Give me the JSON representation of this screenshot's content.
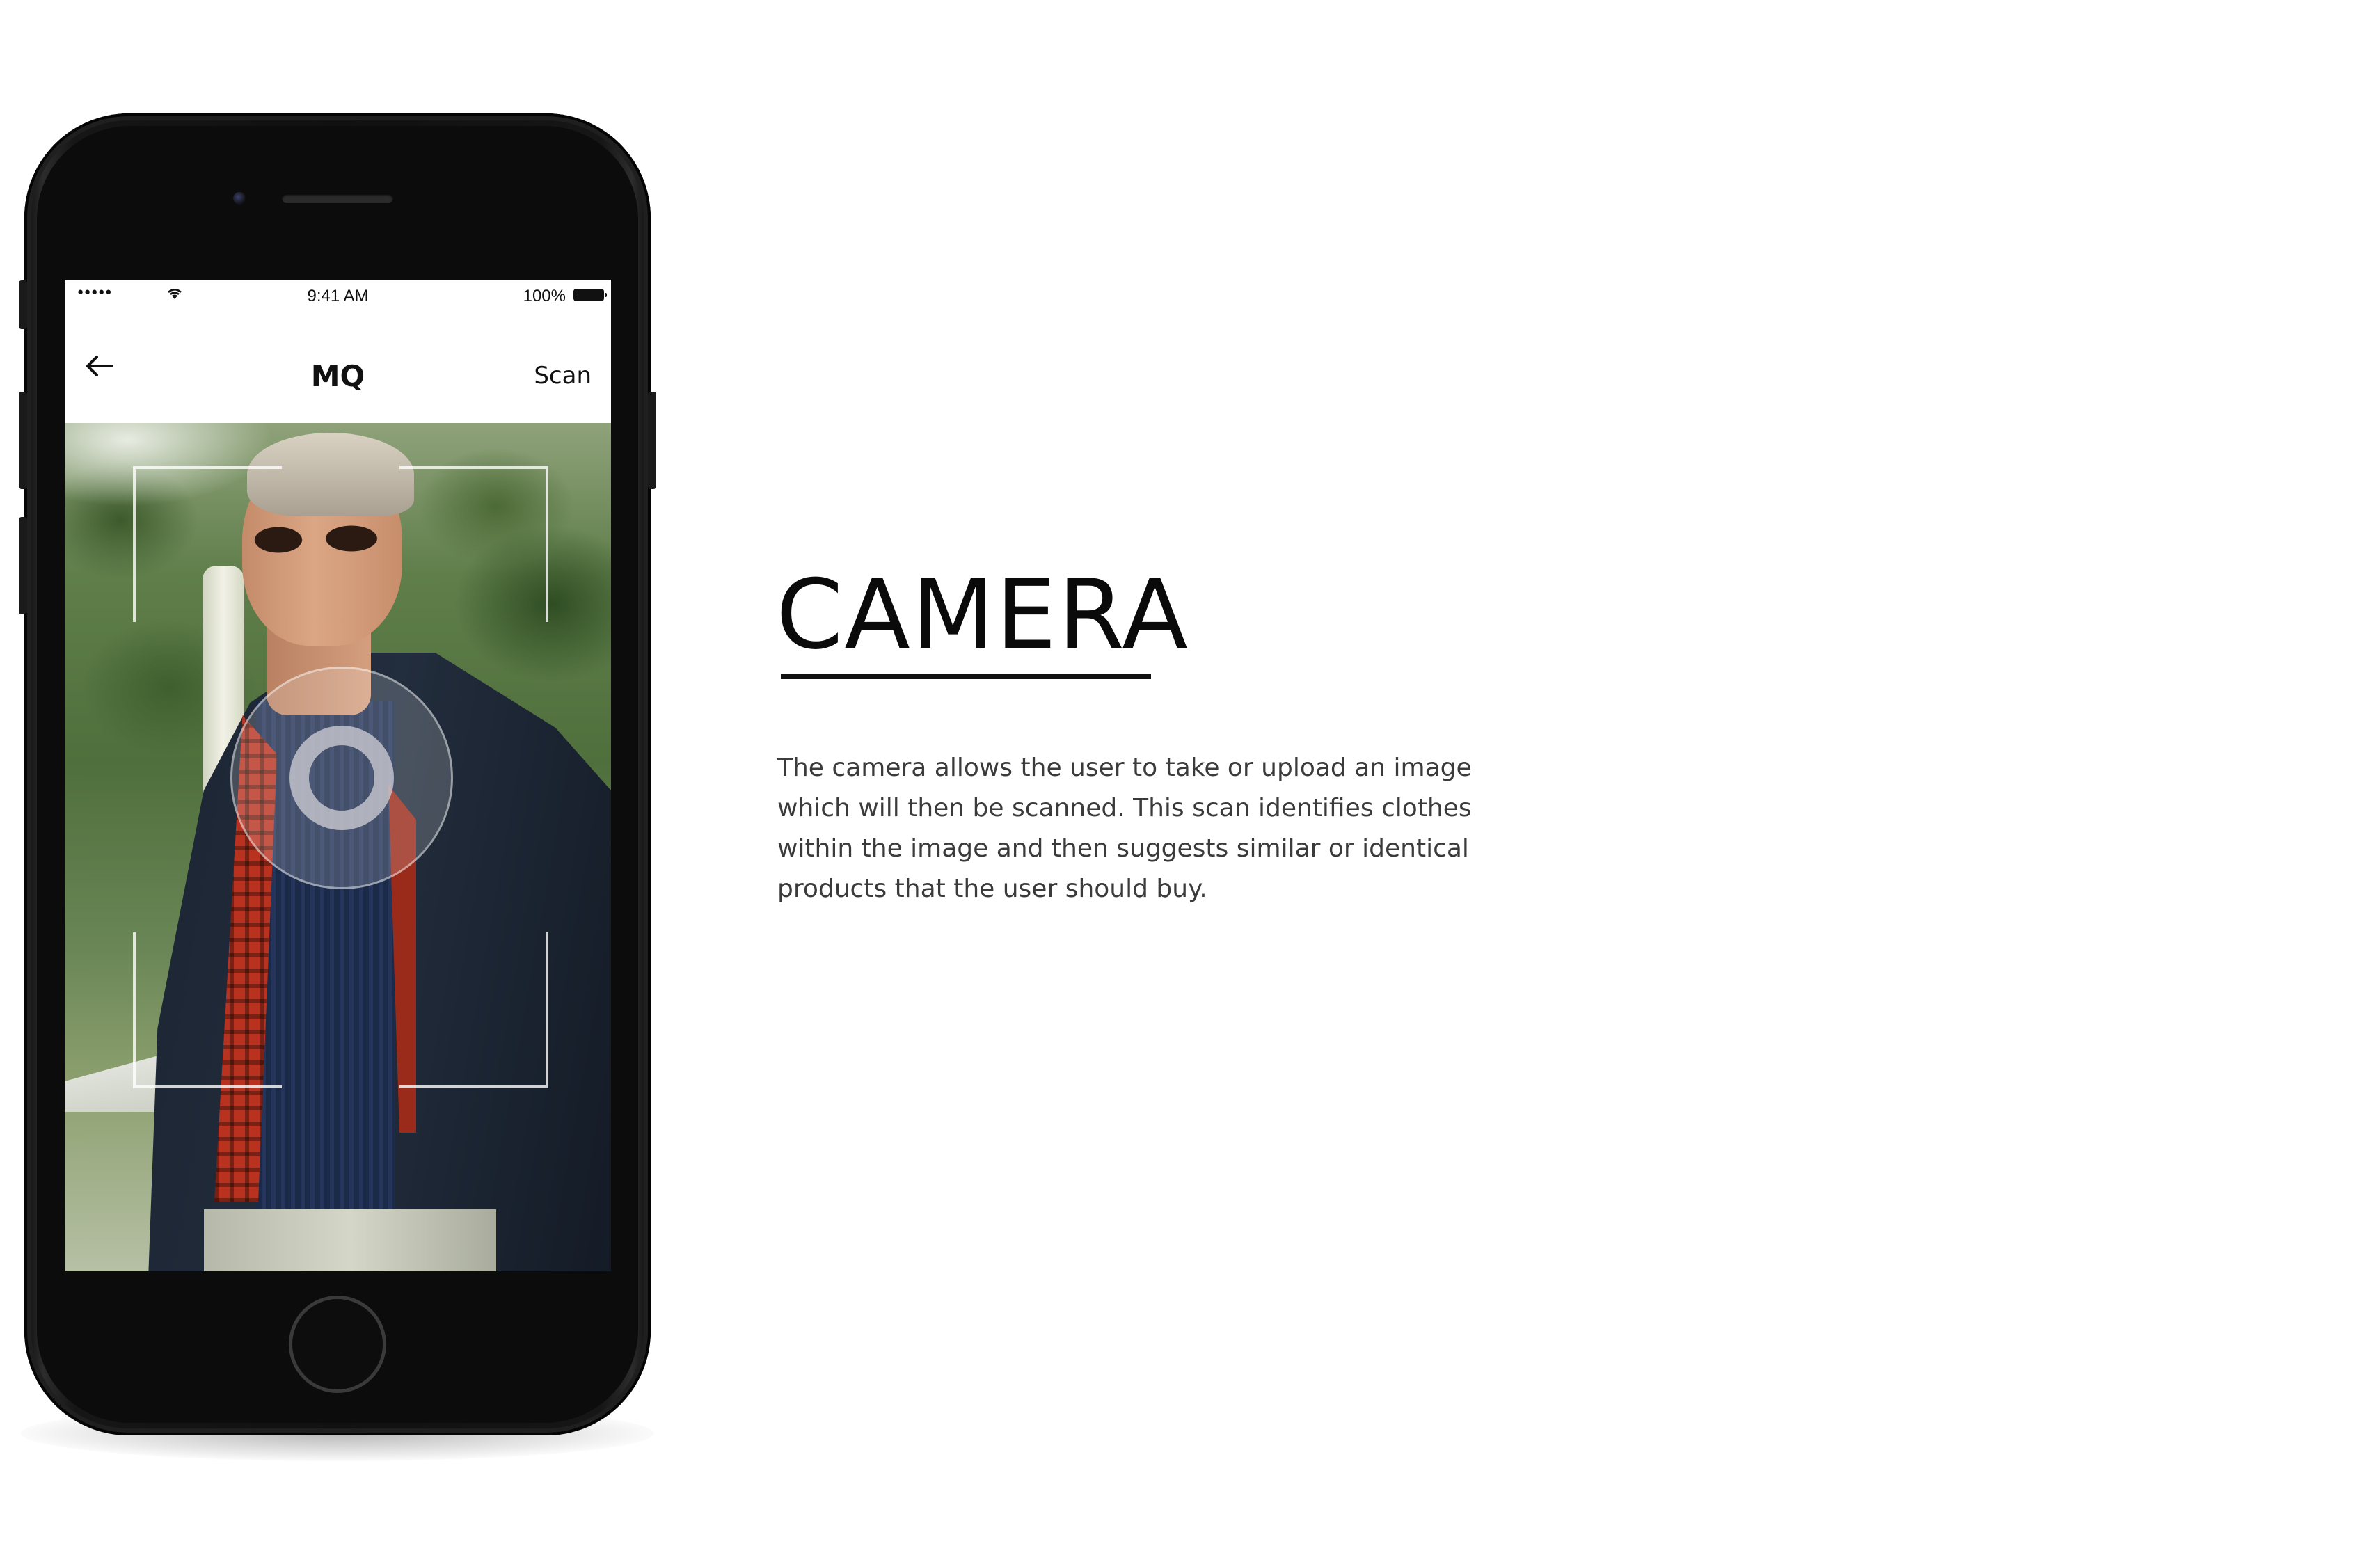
{
  "status_bar": {
    "signal": "●●●●●",
    "time": "9:41 AM",
    "battery": "100%"
  },
  "nav": {
    "back_icon": "arrow-left-icon",
    "title": "MQ",
    "action": "Scan"
  },
  "camera": {
    "thumbnail_icon": "gallery-thumbnail",
    "shutter_icon": "shutter-ring-icon",
    "switch_icon": "camera-switch-icon"
  },
  "content": {
    "title": "CAMERA",
    "description": "The camera allows the user to take or upload an image which will then be scanned. This scan identifies clothes within the image and then suggests similar or identical products that the user should buy."
  },
  "colors": {
    "text_primary": "#0a0a0a",
    "text_secondary": "#3b3b3b",
    "phone_body": "#111111",
    "shutter_ring": "#ffffff"
  }
}
